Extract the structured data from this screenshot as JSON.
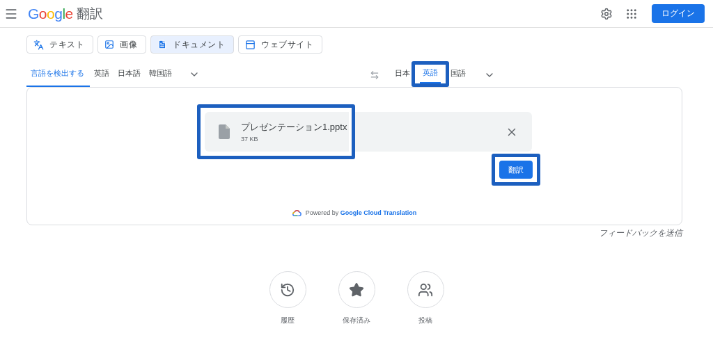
{
  "header": {
    "logo": "Google",
    "title": "翻訳",
    "login": "ログイン"
  },
  "modes": [
    {
      "kind": "text",
      "label": "テキスト",
      "selected": false
    },
    {
      "kind": "image",
      "label": "画像",
      "selected": false
    },
    {
      "kind": "document",
      "label": "ドキュメント",
      "selected": true
    },
    {
      "kind": "website",
      "label": "ウェブサイト",
      "selected": false
    }
  ],
  "source_languages": [
    {
      "label": "言語を検出する",
      "selected": true
    },
    {
      "label": "英語",
      "selected": false
    },
    {
      "label": "日本語",
      "selected": false
    },
    {
      "label": "韓国語",
      "selected": false
    }
  ],
  "target_languages": [
    {
      "label": "日本",
      "selected": false,
      "highlighted": false
    },
    {
      "label": "英語",
      "selected": true,
      "highlighted": true
    },
    {
      "label": "国語",
      "selected": false,
      "highlighted": false
    }
  ],
  "file": {
    "name": "プレゼンテーション1.pptx",
    "size": "37 KB",
    "highlighted": true
  },
  "translate_button": {
    "label": "翻訳",
    "highlighted": true
  },
  "powered_by": {
    "prefix": "Powered by",
    "link": "Google Cloud Translation"
  },
  "feedback": "フィードバックを送信",
  "shortcuts": [
    {
      "kind": "history",
      "label": "履歴"
    },
    {
      "kind": "saved",
      "label": "保存済み"
    },
    {
      "kind": "community",
      "label": "投稿"
    }
  ]
}
